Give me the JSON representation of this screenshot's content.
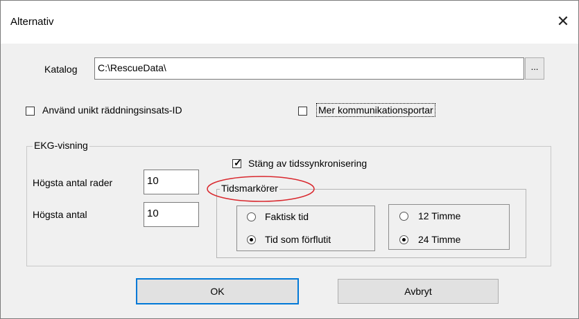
{
  "window": {
    "title": "Alternativ",
    "close_glyph": "✕"
  },
  "catalog": {
    "label": "Katalog",
    "value": "C:\\RescueData\\",
    "browse_label": "..."
  },
  "options": {
    "unique_id_label": "Använd unikt räddningsinsats-ID",
    "unique_id_checked": false,
    "more_ports_label": "Mer kommunikationsportar",
    "more_ports_checked": false
  },
  "ekg": {
    "legend": "EKG-visning",
    "max_rows_label": "Högsta antal rader",
    "max_rows_value": "10",
    "max_count_label": "Högsta antal",
    "max_count_value": "10",
    "disable_sync_label": "Stäng av tidssynkronisering",
    "disable_sync_checked": true,
    "markers": {
      "legend": "Tidsmarkörer",
      "time_mode": [
        {
          "label": "Faktisk tid",
          "selected": false
        },
        {
          "label": "Tid som förflutit",
          "selected": true
        }
      ],
      "clock_format": [
        {
          "label": "12 Timme",
          "selected": false
        },
        {
          "label": "24 Timme",
          "selected": true
        }
      ]
    }
  },
  "buttons": {
    "ok": "OK",
    "cancel": "Avbryt"
  },
  "colors": {
    "annotation_ring": "#d9262c",
    "accent": "#0078d7"
  }
}
